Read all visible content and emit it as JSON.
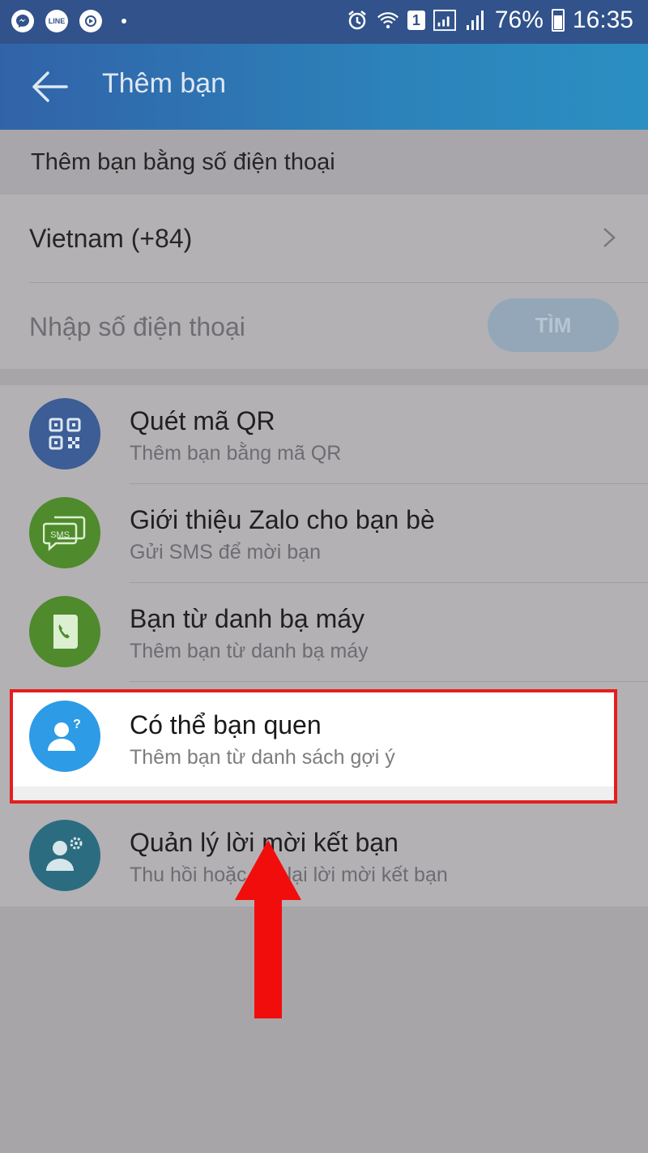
{
  "status_bar": {
    "apps": [
      "messenger-icon",
      "line-icon",
      "podcast-icon"
    ],
    "line_label": "LINE",
    "sim": "1",
    "battery": "76%",
    "time": "16:35"
  },
  "header": {
    "title": "Thêm bạn"
  },
  "section": {
    "add_by_phone": "Thêm bạn bằng số điện thoại"
  },
  "phone": {
    "country": "Vietnam (+84)",
    "placeholder": "Nhập số điện thoại",
    "find_label": "TÌM"
  },
  "items": [
    {
      "title": "Quét mã QR",
      "subtitle": "Thêm bạn bằng mã QR",
      "icon": "qr-icon",
      "color": "#3c5d95"
    },
    {
      "title": "Giới thiệu Zalo cho bạn bè",
      "subtitle": "Gửi SMS để mời bạn",
      "icon": "sms-icon",
      "color": "#4f8a2c",
      "badge": "SMS"
    },
    {
      "title": "Bạn từ danh bạ máy",
      "subtitle": "Thêm bạn từ danh bạ máy",
      "icon": "phonebook-icon",
      "color": "#4f8a2c"
    },
    {
      "title": "Có thể bạn quen",
      "subtitle": "Thêm bạn từ danh sách gợi ý",
      "icon": "suggested-friend-icon",
      "color": "#2d9be6"
    },
    {
      "title": "Quản lý lời mời kết bạn",
      "subtitle": "Thu hồi hoặc gửi lại lời mời kết bạn",
      "icon": "friend-request-icon",
      "color": "#2c6c81"
    }
  ],
  "colors": {
    "highlight": "#e41e1e",
    "arrow": "#f20d0d",
    "appbar": "#2c82ba"
  }
}
